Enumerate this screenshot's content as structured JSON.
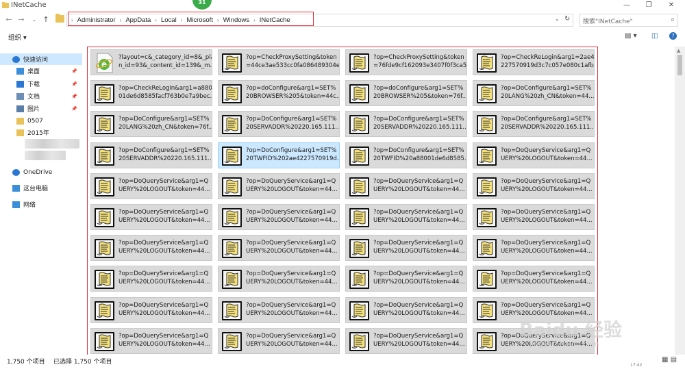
{
  "window": {
    "title": "INetCache",
    "minimize": "—",
    "maximize": "❐",
    "close": "✕"
  },
  "badge": "31",
  "nav": {
    "back": "←",
    "forward": "→",
    "dropdown": "⌄",
    "up": "↑"
  },
  "address": {
    "crumbs": [
      "Administrator",
      "AppData",
      "Local",
      "Microsoft",
      "Windows",
      "INetCache"
    ],
    "separator": "›",
    "dropdown": "⌄",
    "refresh": "↻"
  },
  "search": {
    "placeholder": "搜索\"INetCache\"",
    "icon": "⌕"
  },
  "toolbar": {
    "organize": "组织 ▾",
    "view": "▤ ▾",
    "preview": "◫",
    "help": "?"
  },
  "sidebar": {
    "items": [
      {
        "label": "快速访问",
        "icon": "star-icon"
      },
      {
        "label": "桌面",
        "icon": "desktop-icon"
      },
      {
        "label": "下载",
        "icon": "download-icon"
      },
      {
        "label": "文档",
        "icon": "document-icon"
      },
      {
        "label": "图片",
        "icon": "picture-icon"
      },
      {
        "label": "0507",
        "icon": "folder-icon"
      },
      {
        "label": "2015年",
        "icon": "folder-icon"
      },
      {
        "label": "OneDrive",
        "icon": "cloud-icon"
      },
      {
        "label": "这台电脑",
        "icon": "computer-icon"
      },
      {
        "label": "网络",
        "icon": "network-icon"
      }
    ],
    "pin": "📌"
  },
  "files": [
    {
      "l1": "?layout=c&_category_id=8&_pla",
      "l2": "n_id=93&_content_id=139&_m...",
      "icon": "ie-page-icon"
    },
    {
      "l1": "?op=CheckProxySetting&token",
      "l2": "=44ce3ae533cc0fa086489304e...",
      "icon": "config-file-icon"
    },
    {
      "l1": "?op=CheckProxySetting&token",
      "l2": "=76fde9cf162093e3407f0f3ca5...",
      "icon": "config-file-icon"
    },
    {
      "l1": "?op=CheckReLogin&arg1=2ae4",
      "l2": "227570919d3c7c057e080c1afb...",
      "icon": "config-file-icon"
    },
    {
      "l1": "?op=CheckReLogin&arg1=a880",
      "l2": "01de6d8585facf763b0e7a9bec...",
      "icon": "config-file-icon"
    },
    {
      "l1": "?op=doConfigure&arg1=SET%",
      "l2": "20BROWSER%205&token=44c...",
      "icon": "config-file-icon"
    },
    {
      "l1": "?op=doConfigure&arg1=SET%",
      "l2": "20BROWSER%205&token=76f...",
      "icon": "config-file-icon"
    },
    {
      "l1": "?op=DoConfigure&arg1=SET%",
      "l2": "20LANG%20zh_CN&token=44...",
      "icon": "config-file-icon"
    },
    {
      "l1": "?op=DoConfigure&arg1=SET%",
      "l2": "20LANG%20zh_CN&token=76f...",
      "icon": "config-file-icon"
    },
    {
      "l1": "?op=DoConfigure&arg1=SET%",
      "l2": "20SERVADDR%20220.165.111....",
      "icon": "config-file-icon"
    },
    {
      "l1": "?op=DoConfigure&arg1=SET%",
      "l2": "20SERVADDR%20220.165.111....",
      "icon": "config-file-icon"
    },
    {
      "l1": "?op=DoConfigure&arg1=SET%",
      "l2": "20SERVADDR%20220.165.111....",
      "icon": "config-file-icon"
    },
    {
      "l1": "?op=DoConfigure&arg1=SET%",
      "l2": "20SERVADDR%20220.165.111....",
      "icon": "config-file-icon"
    },
    {
      "l1": "?op=DoConfigure&arg1=SET%",
      "l2": "20TWFID%202ae4227570919d...",
      "icon": "config-file-icon",
      "selected": true
    },
    {
      "l1": "?op=DoConfigure&arg1=SET%",
      "l2": "20TWFID%20a88001de6d8585...",
      "icon": "config-file-icon"
    },
    {
      "l1": "?op=DoQueryService&arg1=Q",
      "l2": "UERY%20LOGOUT&token=44...",
      "icon": "config-file-icon"
    },
    {
      "l1": "?op=DoQueryService&arg1=Q",
      "l2": "UERY%20LOGOUT&token=44...",
      "icon": "config-file-icon"
    },
    {
      "l1": "?op=DoQueryService&arg1=Q",
      "l2": "UERY%20LOGOUT&token=44...",
      "icon": "config-file-icon"
    },
    {
      "l1": "?op=DoQueryService&arg1=Q",
      "l2": "UERY%20LOGOUT&token=44...",
      "icon": "config-file-icon"
    },
    {
      "l1": "?op=DoQueryService&arg1=Q",
      "l2": "UERY%20LOGOUT&token=44...",
      "icon": "config-file-icon"
    },
    {
      "l1": "?op=DoQueryService&arg1=Q",
      "l2": "UERY%20LOGOUT&token=44...",
      "icon": "config-file-icon"
    },
    {
      "l1": "?op=DoQueryService&arg1=Q",
      "l2": "UERY%20LOGOUT&token=44...",
      "icon": "config-file-icon"
    },
    {
      "l1": "?op=DoQueryService&arg1=Q",
      "l2": "UERY%20LOGOUT&token=44...",
      "icon": "config-file-icon"
    },
    {
      "l1": "?op=DoQueryService&arg1=Q",
      "l2": "UERY%20LOGOUT&token=44...",
      "icon": "config-file-icon"
    },
    {
      "l1": "?op=DoQueryService&arg1=Q",
      "l2": "UERY%20LOGOUT&token=44...",
      "icon": "config-file-icon"
    },
    {
      "l1": "?op=DoQueryService&arg1=Q",
      "l2": "UERY%20LOGOUT&token=44...",
      "icon": "config-file-icon"
    },
    {
      "l1": "?op=DoQueryService&arg1=Q",
      "l2": "UERY%20LOGOUT&token=44...",
      "icon": "config-file-icon"
    },
    {
      "l1": "?op=DoQueryService&arg1=Q",
      "l2": "UERY%20LOGOUT&token=44...",
      "icon": "config-file-icon"
    },
    {
      "l1": "?op=DoQueryService&arg1=Q",
      "l2": "UERY%20LOGOUT&token=44...",
      "icon": "config-file-icon"
    },
    {
      "l1": "?op=DoQueryService&arg1=Q",
      "l2": "UERY%20LOGOUT&token=44...",
      "icon": "config-file-icon"
    },
    {
      "l1": "?op=DoQueryService&arg1=Q",
      "l2": "UERY%20LOGOUT&token=44...",
      "icon": "config-file-icon"
    },
    {
      "l1": "?op=DoQueryService&arg1=Q",
      "l2": "UERY%20LOGOUT&token=44...",
      "icon": "config-file-icon"
    },
    {
      "l1": "?op=DoQueryService&arg1=Q",
      "l2": "UERY%20LOGOUT&token=44...",
      "icon": "config-file-icon"
    },
    {
      "l1": "?op=DoQueryService&arg1=Q",
      "l2": "UERY%20LOGOUT&token=44...",
      "icon": "config-file-icon"
    },
    {
      "l1": "?op=DoQueryService&arg1=Q",
      "l2": "UERY%20LOGOUT&token=44...",
      "icon": "config-file-icon"
    },
    {
      "l1": "?op=DoQueryService&arg1=Q",
      "l2": "UERY%20LOGOUT&token=44...",
      "icon": "config-file-icon"
    },
    {
      "l1": "?op=DoQueryService&arg1=Q",
      "l2": "UERY%20LOGOUT&token=44...",
      "icon": "config-file-icon"
    },
    {
      "l1": "?op=DoQueryService&arg1=Q",
      "l2": "UERY%20LOGOUT&token=44...",
      "icon": "config-file-icon"
    },
    {
      "l1": "?op=DoQueryService&arg1=Q",
      "l2": "UERY%20LOGOUT&token=44...",
      "icon": "config-file-icon"
    },
    {
      "l1": "?op=DoQueryService&arg1=Q",
      "l2": "UERY%20LOGOUT&token=44...",
      "icon": "config-file-icon"
    },
    {
      "l1": "?op=DoQueryService&arg1=Q",
      "l2": "",
      "icon": "config-file-icon"
    },
    {
      "l1": "?op=DoQueryService&arg1=Q",
      "l2": "",
      "icon": "config-file-icon"
    },
    {
      "l1": "?op=DoQueryService&arg1=Q",
      "l2": "",
      "icon": "config-file-icon"
    },
    {
      "l1": "?op=DoQueryService&arg1=Q",
      "l2": "",
      "icon": "config-file-icon"
    }
  ],
  "status": {
    "count": "1,750 个项目",
    "selected": "已选择 1,750 个项目",
    "views": "▦ ▤",
    "clock": "17:42"
  },
  "watermark": {
    "logo": "Baidu 经验",
    "url": "jingyan.baidu.com"
  },
  "colors": {
    "highlight_box": "#e0303a",
    "selected_tile": "#cce8ff",
    "tile_bg": "#dadada",
    "badge": "#3aaa4b"
  }
}
